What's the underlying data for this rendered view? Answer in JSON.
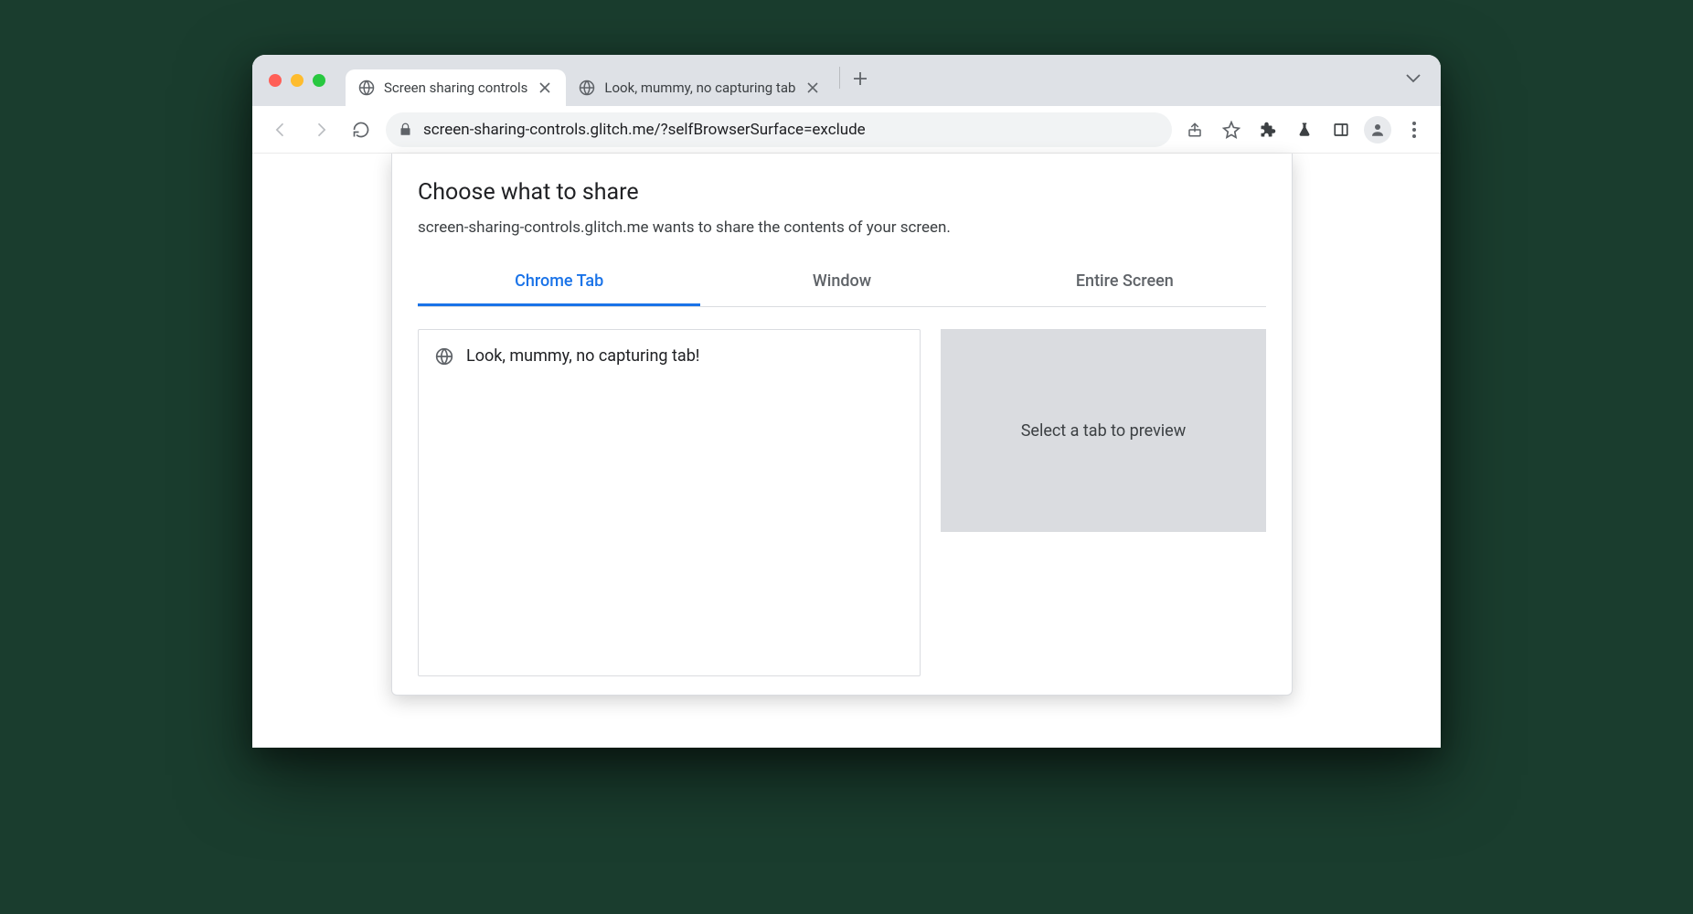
{
  "browser": {
    "tabs": [
      {
        "title": "Screen sharing controls",
        "active": true
      },
      {
        "title": "Look, mummy, no capturing tab",
        "active": false
      }
    ],
    "url": "screen-sharing-controls.glitch.me/?selfBrowserSurface=exclude"
  },
  "dialog": {
    "title": "Choose what to share",
    "subtitle": "screen-sharing-controls.glitch.me wants to share the contents of your screen.",
    "source_tabs": {
      "chrome_tab": "Chrome Tab",
      "window": "Window",
      "entire_screen": "Entire Screen"
    },
    "tab_list": [
      {
        "title": "Look, mummy, no capturing tab!"
      }
    ],
    "preview_placeholder": "Select a tab to preview"
  }
}
